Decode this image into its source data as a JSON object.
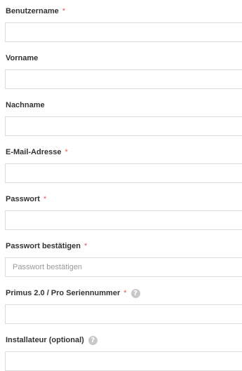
{
  "form": {
    "fields": [
      {
        "label": "Benutzername",
        "required": true,
        "help": false,
        "value": "",
        "placeholder": ""
      },
      {
        "label": "Vorname",
        "required": false,
        "help": false,
        "value": "",
        "placeholder": ""
      },
      {
        "label": "Nachname",
        "required": false,
        "help": false,
        "value": "",
        "placeholder": ""
      },
      {
        "label": "E-Mail-Adresse",
        "required": true,
        "help": false,
        "value": "",
        "placeholder": ""
      },
      {
        "label": "Passwort",
        "required": true,
        "help": false,
        "value": "",
        "placeholder": ""
      },
      {
        "label": "Passwort bestätigen",
        "required": true,
        "help": false,
        "value": "",
        "placeholder": "Passwort bestätigen"
      },
      {
        "label": "Primus 2.0 / Pro Seriennummer",
        "required": true,
        "help": true,
        "value": "",
        "placeholder": ""
      },
      {
        "label": "Installateur (optional)",
        "required": false,
        "help": true,
        "value": "",
        "placeholder": ""
      }
    ],
    "required_mark": "*",
    "help_glyph": "?"
  },
  "colors": {
    "required_mark": "#e25c5c",
    "input_border": "#dcdcdc",
    "help_icon_bg": "#c8c8c8"
  }
}
